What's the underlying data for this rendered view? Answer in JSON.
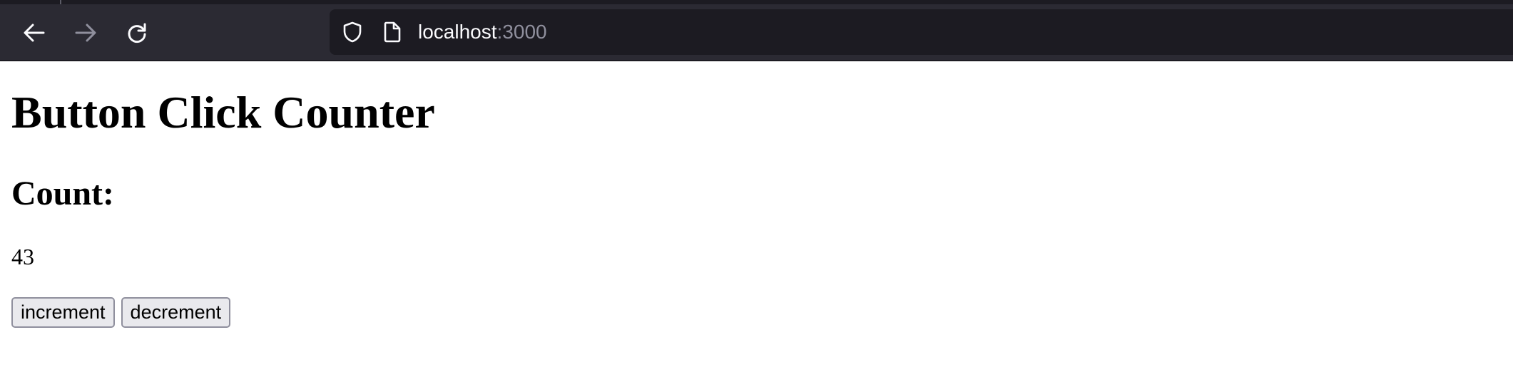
{
  "browser": {
    "url_host": "localhost",
    "url_port": ":3000",
    "back_icon": "arrow-left-icon",
    "forward_icon": "arrow-right-icon",
    "reload_icon": "reload-icon",
    "tracking_icon": "shield-icon",
    "page_icon": "document-icon"
  },
  "page": {
    "title": "Button Click Counter",
    "count_label": "Count:",
    "count_value": "43",
    "increment_label": "increment",
    "decrement_label": "decrement"
  }
}
